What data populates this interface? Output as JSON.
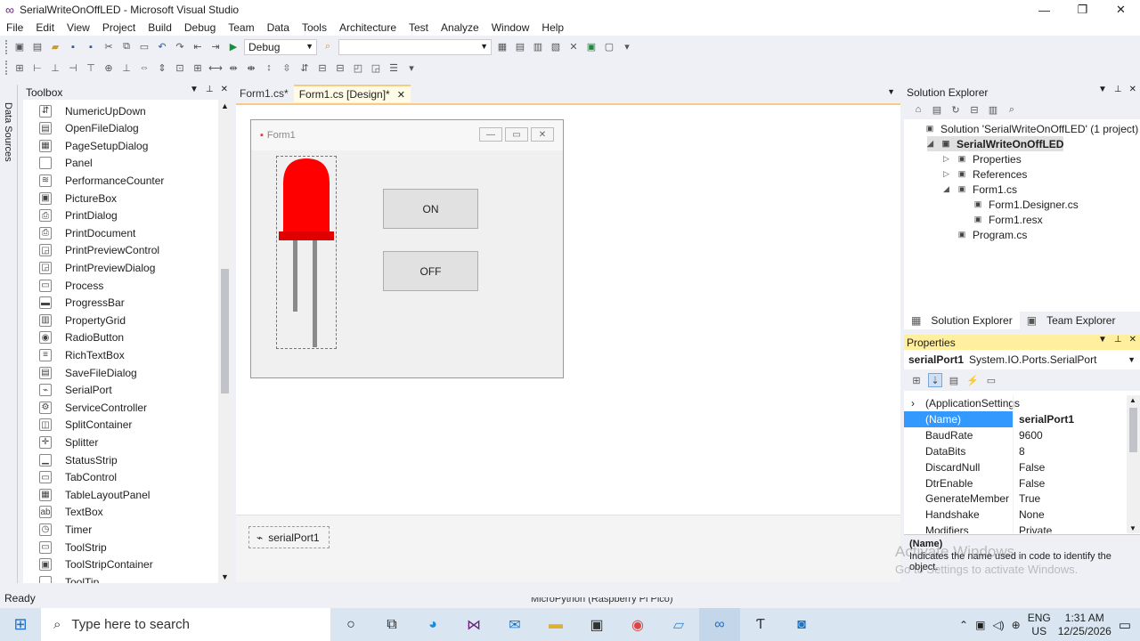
{
  "window": {
    "title": "SerialWriteOnOffLED - Microsoft Visual Studio",
    "minimize": "—",
    "restore": "❐",
    "close": "✕"
  },
  "menu": [
    "File",
    "Edit",
    "View",
    "Project",
    "Build",
    "Debug",
    "Team",
    "Data",
    "Tools",
    "Architecture",
    "Test",
    "Analyze",
    "Window",
    "Help"
  ],
  "toolbar": {
    "config": "Debug",
    "platform": ""
  },
  "leftstrip": {
    "label": "Data Sources"
  },
  "toolbox": {
    "title": "Toolbox",
    "items": [
      {
        "label": "NumericUpDown",
        "icon": "numeric-updown-icon",
        "glyph": "⇵"
      },
      {
        "label": "OpenFileDialog",
        "icon": "open-file-dialog-icon",
        "glyph": "▤"
      },
      {
        "label": "PageSetupDialog",
        "icon": "page-setup-icon",
        "glyph": "▦"
      },
      {
        "label": "Panel",
        "icon": "panel-icon",
        "glyph": ""
      },
      {
        "label": "PerformanceCounter",
        "icon": "performance-counter-icon",
        "glyph": "≋"
      },
      {
        "label": "PictureBox",
        "icon": "picturebox-icon",
        "glyph": "▣"
      },
      {
        "label": "PrintDialog",
        "icon": "print-dialog-icon",
        "glyph": "⎙"
      },
      {
        "label": "PrintDocument",
        "icon": "print-document-icon",
        "glyph": "⎙"
      },
      {
        "label": "PrintPreviewControl",
        "icon": "print-preview-control-icon",
        "glyph": "◲"
      },
      {
        "label": "PrintPreviewDialog",
        "icon": "print-preview-dialog-icon",
        "glyph": "◲"
      },
      {
        "label": "Process",
        "icon": "process-icon",
        "glyph": "▭"
      },
      {
        "label": "ProgressBar",
        "icon": "progressbar-icon",
        "glyph": "▬"
      },
      {
        "label": "PropertyGrid",
        "icon": "property-grid-icon",
        "glyph": "▥"
      },
      {
        "label": "RadioButton",
        "icon": "radio-button-icon",
        "glyph": "◉"
      },
      {
        "label": "RichTextBox",
        "icon": "rich-textbox-icon",
        "glyph": "≡"
      },
      {
        "label": "SaveFileDialog",
        "icon": "save-file-dialog-icon",
        "glyph": "▤"
      },
      {
        "label": "SerialPort",
        "icon": "serial-port-icon",
        "glyph": "⌁"
      },
      {
        "label": "ServiceController",
        "icon": "service-controller-icon",
        "glyph": "⚙"
      },
      {
        "label": "SplitContainer",
        "icon": "split-container-icon",
        "glyph": "◫"
      },
      {
        "label": "Splitter",
        "icon": "splitter-icon",
        "glyph": "✛"
      },
      {
        "label": "StatusStrip",
        "icon": "status-strip-icon",
        "glyph": "▁"
      },
      {
        "label": "TabControl",
        "icon": "tab-control-icon",
        "glyph": "▭"
      },
      {
        "label": "TableLayoutPanel",
        "icon": "table-layout-panel-icon",
        "glyph": "▦"
      },
      {
        "label": "TextBox",
        "icon": "textbox-icon",
        "glyph": "ab"
      },
      {
        "label": "Timer",
        "icon": "timer-icon",
        "glyph": "◷"
      },
      {
        "label": "ToolStrip",
        "icon": "toolstrip-icon",
        "glyph": "▭"
      },
      {
        "label": "ToolStripContainer",
        "icon": "toolstrip-container-icon",
        "glyph": "▣"
      },
      {
        "label": "ToolTip",
        "icon": "tooltip-icon",
        "glyph": ""
      }
    ]
  },
  "tabs": [
    {
      "label": "Form1.cs*",
      "active": false
    },
    {
      "label": "Form1.cs [Design]*",
      "active": true
    }
  ],
  "form": {
    "title": "Form1",
    "on_label": "ON",
    "off_label": "OFF"
  },
  "component_tray": {
    "item": "serialPort1"
  },
  "solution_explorer": {
    "title": "Solution Explorer",
    "tree": [
      {
        "label": "Solution 'SerialWriteOnOffLED' (1 project)",
        "indent": 0,
        "exp": "",
        "icon": "solution-icon",
        "bold": false
      },
      {
        "label": "SerialWriteOnOffLED",
        "indent": 1,
        "exp": "◢",
        "icon": "csharp-project-icon",
        "bold": true
      },
      {
        "label": "Properties",
        "indent": 2,
        "exp": "▷",
        "icon": "folder-icon",
        "bold": false
      },
      {
        "label": "References",
        "indent": 2,
        "exp": "▷",
        "icon": "references-icon",
        "bold": false
      },
      {
        "label": "Form1.cs",
        "indent": 2,
        "exp": "◢",
        "icon": "form-file-icon",
        "bold": false
      },
      {
        "label": "Form1.Designer.cs",
        "indent": 3,
        "exp": "",
        "icon": "csharp-file-icon",
        "bold": false
      },
      {
        "label": "Form1.resx",
        "indent": 3,
        "exp": "",
        "icon": "resx-file-icon",
        "bold": false
      },
      {
        "label": "Program.cs",
        "indent": 2,
        "exp": "",
        "icon": "csharp-file-icon",
        "bold": false
      }
    ],
    "tab_solution": "Solution Explorer",
    "tab_team": "Team Explorer"
  },
  "properties": {
    "title": "Properties",
    "object_name": "serialPort1",
    "object_type": "System.IO.Ports.SerialPort",
    "rows": [
      {
        "name": "(ApplicationSettings",
        "value": "",
        "selected": false,
        "expander": "›"
      },
      {
        "name": "(Name)",
        "value": "serialPort1",
        "selected": true,
        "expander": ""
      },
      {
        "name": "BaudRate",
        "value": "9600",
        "selected": false,
        "expander": ""
      },
      {
        "name": "DataBits",
        "value": "8",
        "selected": false,
        "expander": ""
      },
      {
        "name": "DiscardNull",
        "value": "False",
        "selected": false,
        "expander": ""
      },
      {
        "name": "DtrEnable",
        "value": "False",
        "selected": false,
        "expander": ""
      },
      {
        "name": "GenerateMember",
        "value": "True",
        "selected": false,
        "expander": ""
      },
      {
        "name": "Handshake",
        "value": "None",
        "selected": false,
        "expander": ""
      },
      {
        "name": "Modifiers",
        "value": "Private",
        "selected": false,
        "expander": ""
      }
    ],
    "desc_title": "(Name)",
    "desc_text": "Indicates the name used in code to identify the object."
  },
  "watermark": {
    "line1": "Activate Windows",
    "line2": "Go to Settings to activate Windows."
  },
  "statusbar": {
    "text": "Ready",
    "hidden_tab": "MicroPython (Raspberry Pi Pico)"
  },
  "taskbar": {
    "search_placeholder": "Type here to search",
    "lang1": "ENG",
    "lang2": "US",
    "time": "1:31 AM",
    "date": "12/25/2026"
  }
}
